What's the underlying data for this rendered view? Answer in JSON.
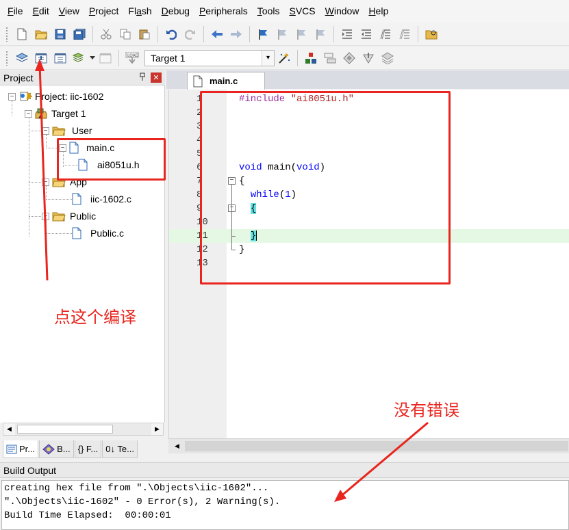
{
  "menu": [
    "File",
    "Edit",
    "View",
    "Project",
    "Flash",
    "Debug",
    "Peripherals",
    "Tools",
    "SVCS",
    "Window",
    "Help"
  ],
  "toolbar": {
    "target_value": "Target 1"
  },
  "project_pane": {
    "title": "Project",
    "pin": "ᵖ",
    "close": "✕",
    "root": "Project: iic-1602",
    "target": "Target 1",
    "group_user": "User",
    "file_main": "main.c",
    "file_header": "ai8051u.h",
    "group_app": "App",
    "file_iic": "iic-1602.c",
    "group_public": "Public",
    "file_public": "Public.c",
    "tabs": [
      "Pr...",
      "B...",
      "{} F...",
      "0↓ Te..."
    ]
  },
  "editor": {
    "tab_label": "main.c",
    "lines": [
      {
        "n": "1"
      },
      {
        "n": "2"
      },
      {
        "n": "3"
      },
      {
        "n": "4"
      },
      {
        "n": "5"
      },
      {
        "n": "6"
      },
      {
        "n": "7"
      },
      {
        "n": "8"
      },
      {
        "n": "9"
      },
      {
        "n": "10"
      },
      {
        "n": "11"
      },
      {
        "n": "12"
      },
      {
        "n": "13"
      }
    ],
    "code": {
      "include_kw": "#include",
      "include_file": "\"ai8051u.h\"",
      "void1": "void",
      "main": " main(",
      "void2": "void",
      "main_close": ")",
      "open_brace": "{",
      "while_kw": "while",
      "while_paren_open": "(",
      "while_num": "1",
      "while_paren_close": ")",
      "inner_open": "{",
      "inner_close": "}",
      "close_brace": "}"
    }
  },
  "build_output": {
    "title": "Build Output",
    "lines": [
      "creating hex file from \".\\Objects\\iic-1602\"...",
      "\".\\Objects\\iic-1602\" - 0 Error(s), 2 Warning(s).",
      "Build Time Elapsed:  00:00:01"
    ]
  },
  "annotations": {
    "compile_note": "点这个编译",
    "no_error_note": "没有错误",
    "color": "#e8251e"
  }
}
